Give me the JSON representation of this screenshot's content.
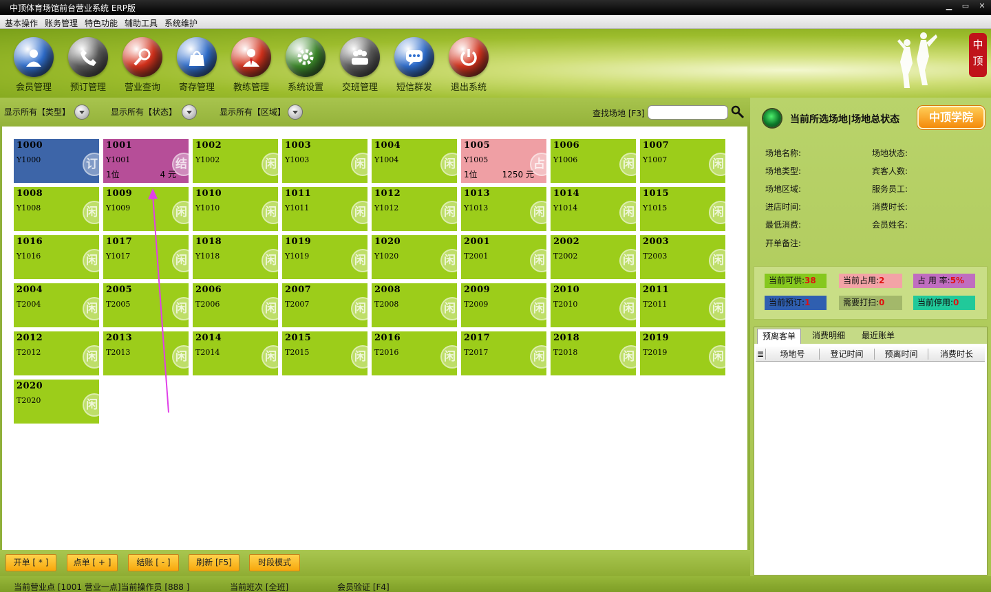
{
  "window": {
    "title": "中顶体育场馆前台营业系统 ERP版",
    "controls": [
      "▁",
      "▭",
      "✕"
    ]
  },
  "menu": [
    "基本操作",
    "账务管理",
    "特色功能",
    "辅助工具",
    "系统维护"
  ],
  "toolbar": [
    {
      "label": "会员管理",
      "icon": "person-icon",
      "color": "#2f6fd0"
    },
    {
      "label": "预订管理",
      "icon": "phone-icon",
      "color": "#5a5a5a"
    },
    {
      "label": "营业查询",
      "icon": "magnifier-icon",
      "color": "#d8321c"
    },
    {
      "label": "寄存管理",
      "icon": "bag-icon",
      "color": "#2f6fd0"
    },
    {
      "label": "教练管理",
      "icon": "coach-icon",
      "color": "#d8321c"
    },
    {
      "label": "系统设置",
      "icon": "gear-icon",
      "color": "#3c8a2a"
    },
    {
      "label": "交班管理",
      "icon": "group-icon",
      "color": "#5a5a5a"
    },
    {
      "label": "短信群发",
      "icon": "chat-icon",
      "color": "#2f6fd0"
    },
    {
      "label": "退出系统",
      "icon": "power-icon",
      "color": "#d8321c"
    }
  ],
  "filters": {
    "type": "显示所有【类型】",
    "status": "显示所有【状态】",
    "area": "显示所有【区域】",
    "search_label": "查找场地 [F3]",
    "search_value": ""
  },
  "tiles": [
    {
      "no": "1000",
      "code": "Y1000",
      "state": "blue",
      "badge": "订"
    },
    {
      "no": "1001",
      "code": "Y1001",
      "state": "purple",
      "badge": "结",
      "people": "1位",
      "amount": "4 元"
    },
    {
      "no": "1002",
      "code": "Y1002",
      "state": "green",
      "badge": "闲"
    },
    {
      "no": "1003",
      "code": "Y1003",
      "state": "green",
      "badge": "闲"
    },
    {
      "no": "1004",
      "code": "Y1004",
      "state": "green",
      "badge": "闲"
    },
    {
      "no": "1005",
      "code": "Y1005",
      "state": "pink",
      "badge": "占",
      "people": "1位",
      "amount": "1250 元"
    },
    {
      "no": "1006",
      "code": "Y1006",
      "state": "green",
      "badge": "闲"
    },
    {
      "no": "1007",
      "code": "Y1007",
      "state": "green",
      "badge": "闲"
    },
    {
      "no": "1008",
      "code": "Y1008",
      "state": "green",
      "badge": "闲"
    },
    {
      "no": "1009",
      "code": "Y1009",
      "state": "green",
      "badge": "闲"
    },
    {
      "no": "1010",
      "code": "Y1010",
      "state": "green",
      "badge": "闲"
    },
    {
      "no": "1011",
      "code": "Y1011",
      "state": "green",
      "badge": "闲"
    },
    {
      "no": "1012",
      "code": "Y1012",
      "state": "green",
      "badge": "闲"
    },
    {
      "no": "1013",
      "code": "Y1013",
      "state": "green",
      "badge": "闲"
    },
    {
      "no": "1014",
      "code": "Y1014",
      "state": "green",
      "badge": "闲"
    },
    {
      "no": "1015",
      "code": "Y1015",
      "state": "green",
      "badge": "闲"
    },
    {
      "no": "1016",
      "code": "Y1016",
      "state": "green",
      "badge": "闲"
    },
    {
      "no": "1017",
      "code": "Y1017",
      "state": "green",
      "badge": "闲"
    },
    {
      "no": "1018",
      "code": "Y1018",
      "state": "green",
      "badge": "闲"
    },
    {
      "no": "1019",
      "code": "Y1019",
      "state": "green",
      "badge": "闲"
    },
    {
      "no": "1020",
      "code": "Y1020",
      "state": "green",
      "badge": "闲"
    },
    {
      "no": "2001",
      "code": "T2001",
      "state": "green",
      "badge": "闲"
    },
    {
      "no": "2002",
      "code": "T2002",
      "state": "green",
      "badge": "闲"
    },
    {
      "no": "2003",
      "code": "T2003",
      "state": "green",
      "badge": "闲"
    },
    {
      "no": "2004",
      "code": "T2004",
      "state": "green",
      "badge": "闲"
    },
    {
      "no": "2005",
      "code": "T2005",
      "state": "green",
      "badge": "闲"
    },
    {
      "no": "2006",
      "code": "T2006",
      "state": "green",
      "badge": "闲"
    },
    {
      "no": "2007",
      "code": "T2007",
      "state": "green",
      "badge": "闲"
    },
    {
      "no": "2008",
      "code": "T2008",
      "state": "green",
      "badge": "闲"
    },
    {
      "no": "2009",
      "code": "T2009",
      "state": "green",
      "badge": "闲"
    },
    {
      "no": "2010",
      "code": "T2010",
      "state": "green",
      "badge": "闲"
    },
    {
      "no": "2011",
      "code": "T2011",
      "state": "green",
      "badge": "闲"
    },
    {
      "no": "2012",
      "code": "T2012",
      "state": "green",
      "badge": "闲"
    },
    {
      "no": "2013",
      "code": "T2013",
      "state": "green",
      "badge": "闲"
    },
    {
      "no": "2014",
      "code": "T2014",
      "state": "green",
      "badge": "闲"
    },
    {
      "no": "2015",
      "code": "T2015",
      "state": "green",
      "badge": "闲"
    },
    {
      "no": "2016",
      "code": "T2016",
      "state": "green",
      "badge": "闲"
    },
    {
      "no": "2017",
      "code": "T2017",
      "state": "green",
      "badge": "闲"
    },
    {
      "no": "2018",
      "code": "T2018",
      "state": "green",
      "badge": "闲"
    },
    {
      "no": "2019",
      "code": "T2019",
      "state": "green",
      "badge": "闲"
    },
    {
      "no": "2020",
      "code": "T2020",
      "state": "green",
      "badge": "闲"
    }
  ],
  "actions": {
    "open": "开单 [ * ]",
    "order": "点单 [ + ]",
    "checkout": "结账 [ - ]",
    "refresh": "刷新 [F5]",
    "period_mode": "时段模式"
  },
  "status_bar": {
    "point": "当前营业点 [1001 营业一点]当前操作员 [888 ]",
    "shift": "当前班次 [全班]",
    "member": "会员验证 [F4]"
  },
  "panel": {
    "title": "当前所选场地|场地总状态",
    "academy": "中顶学院",
    "fields_left": [
      "场地名称:",
      "场地类型:",
      "场地区域:",
      "进店时间:",
      "最低消费:",
      "开单备注:"
    ],
    "fields_right": [
      "场地状态:",
      "宾客人数:",
      "服务员工:",
      "消费时长:",
      "会员姓名:"
    ],
    "stats": [
      {
        "label": "当前可供:",
        "value": "38",
        "color": "#86c81e"
      },
      {
        "label": "当前占用:",
        "value": "2",
        "color": "#f3a3a6"
      },
      {
        "label": "占 用 率:",
        "value": "5%",
        "color": "#c06dc0"
      },
      {
        "label": "当前预订:",
        "value": "1",
        "color": "#2f5fb0"
      },
      {
        "label": "需要打扫:",
        "value": "0",
        "color": "#a3b86a"
      },
      {
        "label": "当前停用:",
        "value": "0",
        "color": "#21c99a"
      }
    ],
    "tabs": [
      "预离客单",
      "消费明细",
      "最近账单"
    ],
    "columns": [
      "场地号",
      "登记时间",
      "预离时间",
      "消费时长"
    ]
  },
  "logo": {
    "brand": "中顶"
  }
}
